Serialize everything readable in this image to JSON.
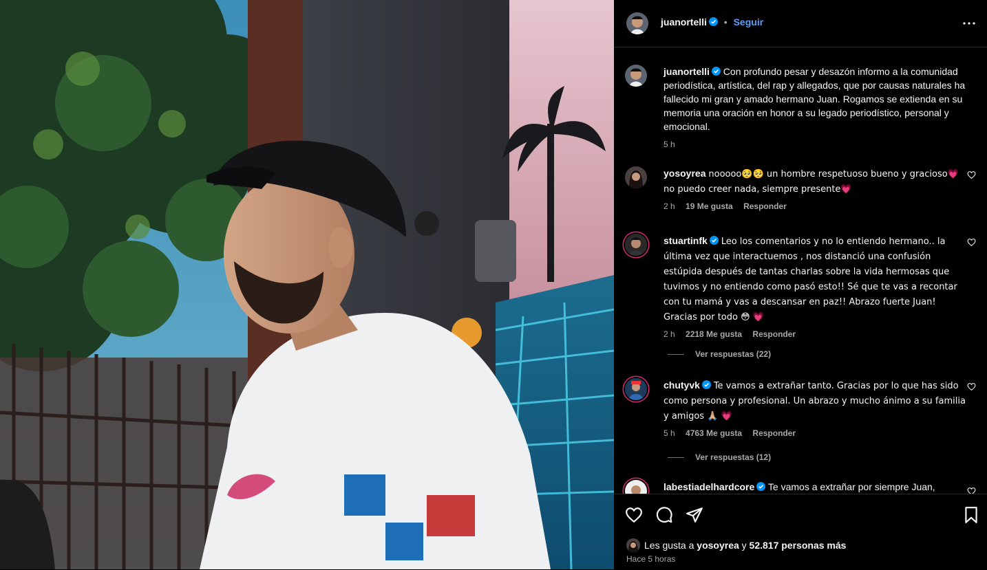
{
  "post": {
    "author": "juanortelli",
    "follow_label": "Seguir",
    "separator": "•",
    "caption": "Con profundo pesar y desazón informo a la comunidad periodística, artística, del rap y allegados, que por causas naturales ha fallecido mi gran y amado hermano Juan. Rogamos se extienda en su memoria una oración en honor a su legado periodístico, personal y emocional.",
    "caption_time": "5 h"
  },
  "comments": [
    {
      "user": "yosoyrea",
      "verified": false,
      "text": "nooooo🥺🥺 un hombre respetuoso bueno y gracioso💗 no puedo creer nada, siempre presente💗",
      "time": "2 h",
      "likes": "19 Me gusta",
      "reply": "Responder"
    },
    {
      "user": "stuartinfk",
      "verified": true,
      "text": "Leo los comentarios y no lo entiendo hermano.. la última vez que interactuemos , nos distanció una confusión estúpida después de tantas charlas sobre la vida hermosas que tuvimos y no entiendo como pasó esto!! Sé que te vas a recontar con tu mamá y vas a descansar en paz!! Abrazo fuerte Juan! Gracias por todo 😳 💗",
      "time": "2 h",
      "likes": "2218 Me gusta",
      "reply": "Responder",
      "view_replies": "Ver respuestas (22)"
    },
    {
      "user": "chutyvk",
      "verified": true,
      "text": "Te vamos a extrañar tanto. Gracias por lo que has sido como persona y profesional. Un abrazo y mucho ánimo a su familia y amigos 🙏🏼 💗",
      "time": "5 h",
      "likes": "4763 Me gusta",
      "reply": "Responder",
      "view_replies": "Ver respuestas (12)"
    },
    {
      "user": "labestiadelhardcore",
      "verified": true,
      "text": "Te vamos a extrañar por siempre Juan,"
    }
  ],
  "footer": {
    "likes_prefix": "Les gusta a",
    "likes_user": "yosoyrea",
    "likes_conj": "y",
    "likes_rest": "52.817 personas más",
    "time": "Hace 5 horas"
  },
  "icons": {
    "like": "heart-icon",
    "comment": "comment-icon",
    "share": "share-icon",
    "save": "bookmark-icon",
    "more": "more-icon",
    "verified": "verified-icon"
  },
  "colors": {
    "background": "#000000",
    "follow": "#5b9df9",
    "verified": "#0095f6",
    "muted": "#a8a8a8",
    "like_heart": "#ff2f6d"
  }
}
